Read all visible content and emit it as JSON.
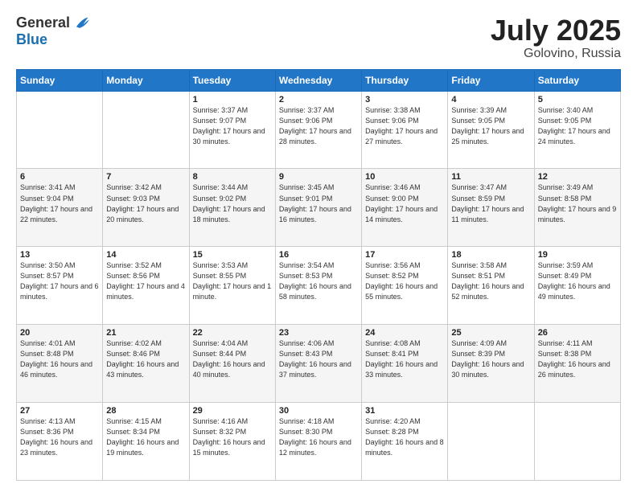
{
  "header": {
    "logo_general": "General",
    "logo_blue": "Blue",
    "title": "July 2025",
    "location": "Golovino, Russia"
  },
  "weekdays": [
    "Sunday",
    "Monday",
    "Tuesday",
    "Wednesday",
    "Thursday",
    "Friday",
    "Saturday"
  ],
  "weeks": [
    [
      {
        "day": "",
        "sunrise": "",
        "sunset": "",
        "daylight": ""
      },
      {
        "day": "",
        "sunrise": "",
        "sunset": "",
        "daylight": ""
      },
      {
        "day": "1",
        "sunrise": "Sunrise: 3:37 AM",
        "sunset": "Sunset: 9:07 PM",
        "daylight": "Daylight: 17 hours and 30 minutes."
      },
      {
        "day": "2",
        "sunrise": "Sunrise: 3:37 AM",
        "sunset": "Sunset: 9:06 PM",
        "daylight": "Daylight: 17 hours and 28 minutes."
      },
      {
        "day": "3",
        "sunrise": "Sunrise: 3:38 AM",
        "sunset": "Sunset: 9:06 PM",
        "daylight": "Daylight: 17 hours and 27 minutes."
      },
      {
        "day": "4",
        "sunrise": "Sunrise: 3:39 AM",
        "sunset": "Sunset: 9:05 PM",
        "daylight": "Daylight: 17 hours and 25 minutes."
      },
      {
        "day": "5",
        "sunrise": "Sunrise: 3:40 AM",
        "sunset": "Sunset: 9:05 PM",
        "daylight": "Daylight: 17 hours and 24 minutes."
      }
    ],
    [
      {
        "day": "6",
        "sunrise": "Sunrise: 3:41 AM",
        "sunset": "Sunset: 9:04 PM",
        "daylight": "Daylight: 17 hours and 22 minutes."
      },
      {
        "day": "7",
        "sunrise": "Sunrise: 3:42 AM",
        "sunset": "Sunset: 9:03 PM",
        "daylight": "Daylight: 17 hours and 20 minutes."
      },
      {
        "day": "8",
        "sunrise": "Sunrise: 3:44 AM",
        "sunset": "Sunset: 9:02 PM",
        "daylight": "Daylight: 17 hours and 18 minutes."
      },
      {
        "day": "9",
        "sunrise": "Sunrise: 3:45 AM",
        "sunset": "Sunset: 9:01 PM",
        "daylight": "Daylight: 17 hours and 16 minutes."
      },
      {
        "day": "10",
        "sunrise": "Sunrise: 3:46 AM",
        "sunset": "Sunset: 9:00 PM",
        "daylight": "Daylight: 17 hours and 14 minutes."
      },
      {
        "day": "11",
        "sunrise": "Sunrise: 3:47 AM",
        "sunset": "Sunset: 8:59 PM",
        "daylight": "Daylight: 17 hours and 11 minutes."
      },
      {
        "day": "12",
        "sunrise": "Sunrise: 3:49 AM",
        "sunset": "Sunset: 8:58 PM",
        "daylight": "Daylight: 17 hours and 9 minutes."
      }
    ],
    [
      {
        "day": "13",
        "sunrise": "Sunrise: 3:50 AM",
        "sunset": "Sunset: 8:57 PM",
        "daylight": "Daylight: 17 hours and 6 minutes."
      },
      {
        "day": "14",
        "sunrise": "Sunrise: 3:52 AM",
        "sunset": "Sunset: 8:56 PM",
        "daylight": "Daylight: 17 hours and 4 minutes."
      },
      {
        "day": "15",
        "sunrise": "Sunrise: 3:53 AM",
        "sunset": "Sunset: 8:55 PM",
        "daylight": "Daylight: 17 hours and 1 minute."
      },
      {
        "day": "16",
        "sunrise": "Sunrise: 3:54 AM",
        "sunset": "Sunset: 8:53 PM",
        "daylight": "Daylight: 16 hours and 58 minutes."
      },
      {
        "day": "17",
        "sunrise": "Sunrise: 3:56 AM",
        "sunset": "Sunset: 8:52 PM",
        "daylight": "Daylight: 16 hours and 55 minutes."
      },
      {
        "day": "18",
        "sunrise": "Sunrise: 3:58 AM",
        "sunset": "Sunset: 8:51 PM",
        "daylight": "Daylight: 16 hours and 52 minutes."
      },
      {
        "day": "19",
        "sunrise": "Sunrise: 3:59 AM",
        "sunset": "Sunset: 8:49 PM",
        "daylight": "Daylight: 16 hours and 49 minutes."
      }
    ],
    [
      {
        "day": "20",
        "sunrise": "Sunrise: 4:01 AM",
        "sunset": "Sunset: 8:48 PM",
        "daylight": "Daylight: 16 hours and 46 minutes."
      },
      {
        "day": "21",
        "sunrise": "Sunrise: 4:02 AM",
        "sunset": "Sunset: 8:46 PM",
        "daylight": "Daylight: 16 hours and 43 minutes."
      },
      {
        "day": "22",
        "sunrise": "Sunrise: 4:04 AM",
        "sunset": "Sunset: 8:44 PM",
        "daylight": "Daylight: 16 hours and 40 minutes."
      },
      {
        "day": "23",
        "sunrise": "Sunrise: 4:06 AM",
        "sunset": "Sunset: 8:43 PM",
        "daylight": "Daylight: 16 hours and 37 minutes."
      },
      {
        "day": "24",
        "sunrise": "Sunrise: 4:08 AM",
        "sunset": "Sunset: 8:41 PM",
        "daylight": "Daylight: 16 hours and 33 minutes."
      },
      {
        "day": "25",
        "sunrise": "Sunrise: 4:09 AM",
        "sunset": "Sunset: 8:39 PM",
        "daylight": "Daylight: 16 hours and 30 minutes."
      },
      {
        "day": "26",
        "sunrise": "Sunrise: 4:11 AM",
        "sunset": "Sunset: 8:38 PM",
        "daylight": "Daylight: 16 hours and 26 minutes."
      }
    ],
    [
      {
        "day": "27",
        "sunrise": "Sunrise: 4:13 AM",
        "sunset": "Sunset: 8:36 PM",
        "daylight": "Daylight: 16 hours and 23 minutes."
      },
      {
        "day": "28",
        "sunrise": "Sunrise: 4:15 AM",
        "sunset": "Sunset: 8:34 PM",
        "daylight": "Daylight: 16 hours and 19 minutes."
      },
      {
        "day": "29",
        "sunrise": "Sunrise: 4:16 AM",
        "sunset": "Sunset: 8:32 PM",
        "daylight": "Daylight: 16 hours and 15 minutes."
      },
      {
        "day": "30",
        "sunrise": "Sunrise: 4:18 AM",
        "sunset": "Sunset: 8:30 PM",
        "daylight": "Daylight: 16 hours and 12 minutes."
      },
      {
        "day": "31",
        "sunrise": "Sunrise: 4:20 AM",
        "sunset": "Sunset: 8:28 PM",
        "daylight": "Daylight: 16 hours and 8 minutes."
      },
      {
        "day": "",
        "sunrise": "",
        "sunset": "",
        "daylight": ""
      },
      {
        "day": "",
        "sunrise": "",
        "sunset": "",
        "daylight": ""
      }
    ]
  ]
}
